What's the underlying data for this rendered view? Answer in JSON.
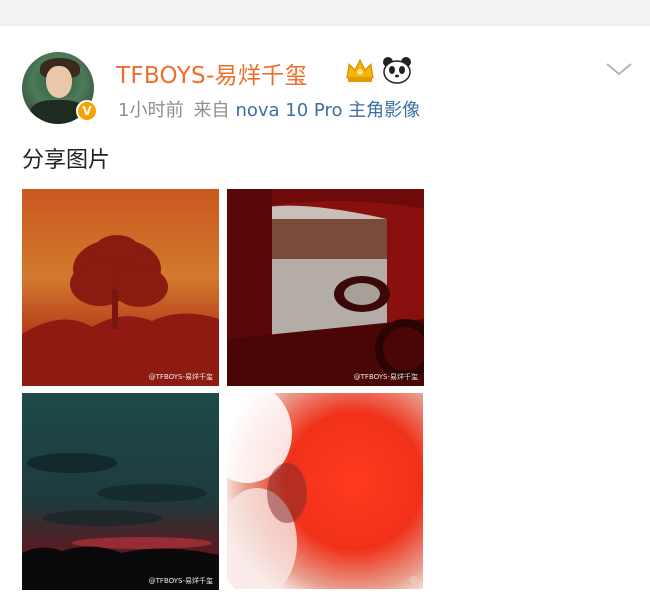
{
  "post": {
    "username": "TFBOYS-易烊千玺",
    "time": "1小时前",
    "from_label": "来自",
    "device": "nova 10 Pro 主角影像",
    "text": "分享图片",
    "badges": [
      "crown-icon",
      "panda-icon"
    ],
    "verified_badge": "V"
  },
  "photos": [
    {
      "name": "tree-silhouette-photo",
      "watermark": "@TFBOYS-易烊千玺"
    },
    {
      "name": "car-window-photo",
      "watermark": "@TFBOYS-易烊千玺"
    },
    {
      "name": "evening-sky-photo",
      "watermark": "@TFBOYS-易烊千玺"
    },
    {
      "name": "red-blur-photo",
      "watermark": ""
    }
  ],
  "colors": {
    "username": "#f06d2b",
    "meta": "#8f8f8f",
    "device_link": "#3b6ea5",
    "topbar": "#f2f2f2"
  }
}
